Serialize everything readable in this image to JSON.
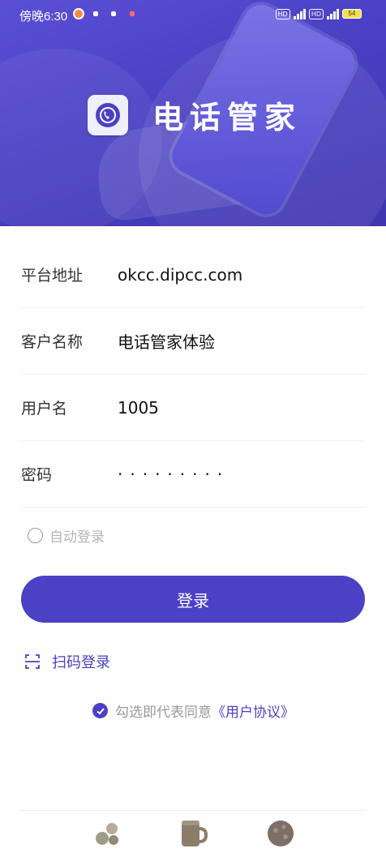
{
  "status_bar": {
    "time": "傍晚6:30",
    "battery": "54"
  },
  "header": {
    "app_name": "电话管家",
    "icon": "phone-app-icon"
  },
  "form": {
    "fields": [
      {
        "label": "平台地址",
        "value": "okcc.dipcc.com"
      },
      {
        "label": "客户名称",
        "value": "电话管家体验"
      },
      {
        "label": "用户名",
        "value": "1005"
      },
      {
        "label": "密码",
        "value": "·········"
      }
    ],
    "auto_login_label": "自动登录",
    "auto_login_checked": false
  },
  "login_button": "登录",
  "scan_login": "扫码登录",
  "agreement": {
    "text": "勾选即代表同意",
    "link": "《用户协议》",
    "checked": true
  },
  "colors": {
    "brand": "#4a41c4",
    "placeholder": "#b5b5b5"
  }
}
